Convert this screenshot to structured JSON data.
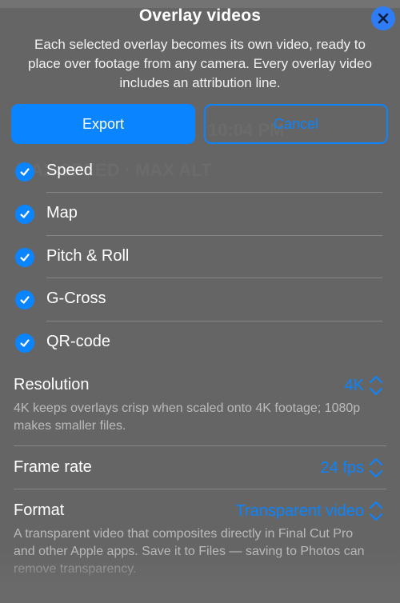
{
  "dialog": {
    "title": "Overlay videos",
    "description": "Each selected overlay becomes its own video, ready to place over footage from any camera. Every overlay video includes an attribution line.",
    "close_icon": "close-icon"
  },
  "buttons": {
    "export": "Export",
    "cancel": "Cancel"
  },
  "overlays": [
    {
      "label": "Speed",
      "checked": true
    },
    {
      "label": "Map",
      "checked": true
    },
    {
      "label": "Pitch & Roll",
      "checked": true
    },
    {
      "label": "G-Cross",
      "checked": true
    },
    {
      "label": "QR-code",
      "checked": true
    }
  ],
  "settings": {
    "resolution": {
      "name": "Resolution",
      "value": "4K",
      "note": "4K keeps overlays crisp when scaled onto 4K footage; 1080p makes smaller files."
    },
    "frame_rate": {
      "name": "Frame rate",
      "value": "24 fps"
    },
    "format": {
      "name": "Format",
      "value": "Transparent video",
      "note": "A transparent video that composites directly in Final Cut Pro and other Apple apps. Save it to Files — saving to Photos can remove transparency."
    }
  },
  "colors": {
    "accent": "#0a84ff",
    "sheet": "#606060"
  }
}
